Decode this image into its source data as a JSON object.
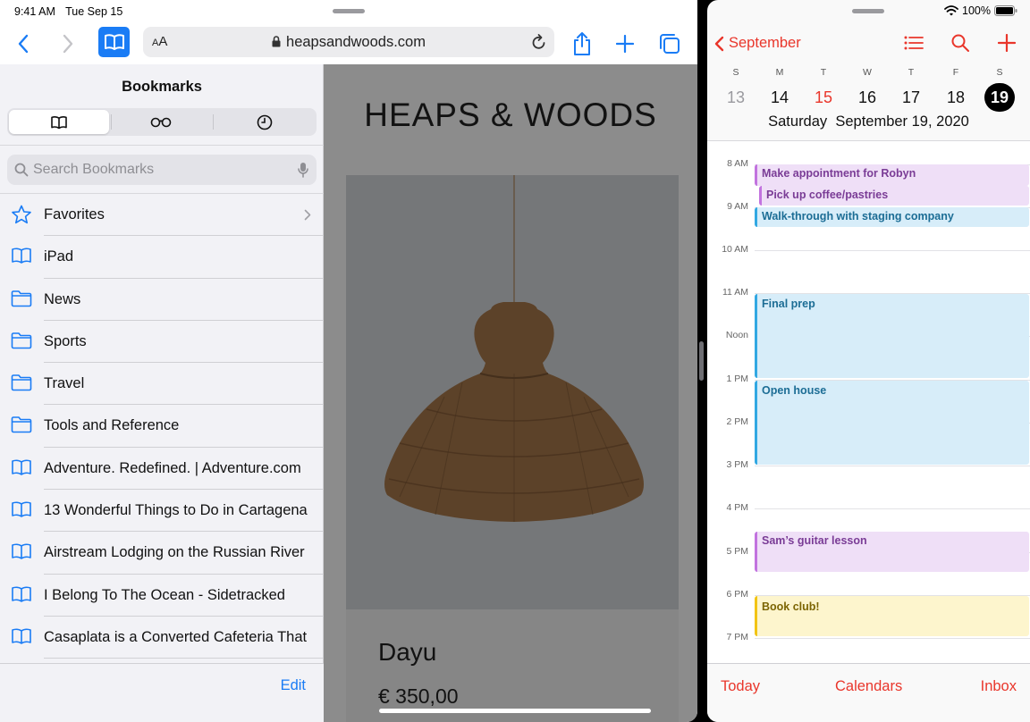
{
  "status_bar": {
    "time": "9:41 AM",
    "date": "Tue Sep 15",
    "battery": "100%"
  },
  "safari": {
    "address": {
      "text_size_label_small": "A",
      "text_size_label_large": "A",
      "url": "heapsandwoods.com"
    },
    "bookmarks": {
      "title": "Bookmarks",
      "search_placeholder": "Search Bookmarks",
      "edit_label": "Edit",
      "items": [
        {
          "label": "Favorites",
          "icon": "star-icon"
        },
        {
          "label": "iPad",
          "icon": "book-icon"
        },
        {
          "label": "News",
          "icon": "folder-icon"
        },
        {
          "label": "Sports",
          "icon": "folder-icon"
        },
        {
          "label": "Travel",
          "icon": "folder-icon"
        },
        {
          "label": "Tools and Reference",
          "icon": "folder-icon"
        },
        {
          "label": "Adventure. Redefined. | Adventure.com",
          "icon": "book-icon"
        },
        {
          "label": "13 Wonderful Things to Do in Cartagena",
          "icon": "book-icon"
        },
        {
          "label": "Airstream Lodging on the Russian River",
          "icon": "book-icon"
        },
        {
          "label": "I Belong To The Ocean - Sidetracked",
          "icon": "book-icon"
        },
        {
          "label": "Casaplata is a Converted Cafeteria That",
          "icon": "book-icon"
        }
      ]
    },
    "webpage": {
      "logo": "HEAPS & WOODS",
      "product_name": "Dayu",
      "product_price": "€ 350,00"
    }
  },
  "calendar": {
    "back_label": "September",
    "week_letters": [
      "S",
      "M",
      "T",
      "W",
      "T",
      "F",
      "S"
    ],
    "week_days": [
      "13",
      "14",
      "15",
      "16",
      "17",
      "18",
      "19"
    ],
    "selected_date": "Saturday  September 19, 2020",
    "hours": [
      "8 AM",
      "9 AM",
      "10 AM",
      "11 AM",
      "Noon",
      "1 PM",
      "2 PM",
      "3 PM",
      "4 PM",
      "5 PM",
      "6 PM",
      "7 PM"
    ],
    "events": [
      {
        "title": "Make appointment for Robyn",
        "color": "purple"
      },
      {
        "title": "Pick up coffee/pastries",
        "color": "purple"
      },
      {
        "title": "Walk-through with staging company",
        "color": "blue"
      },
      {
        "title": "Final prep",
        "color": "blue"
      },
      {
        "title": "Open house",
        "color": "blue"
      },
      {
        "title": "Sam’s guitar lesson",
        "color": "purple"
      },
      {
        "title": "Book club!",
        "color": "yellow"
      }
    ],
    "footer": {
      "today": "Today",
      "calendars": "Calendars",
      "inbox": "Inbox"
    }
  },
  "colors": {
    "safari_accent": "#1a7cf5",
    "calendar_accent": "#e9362b"
  }
}
